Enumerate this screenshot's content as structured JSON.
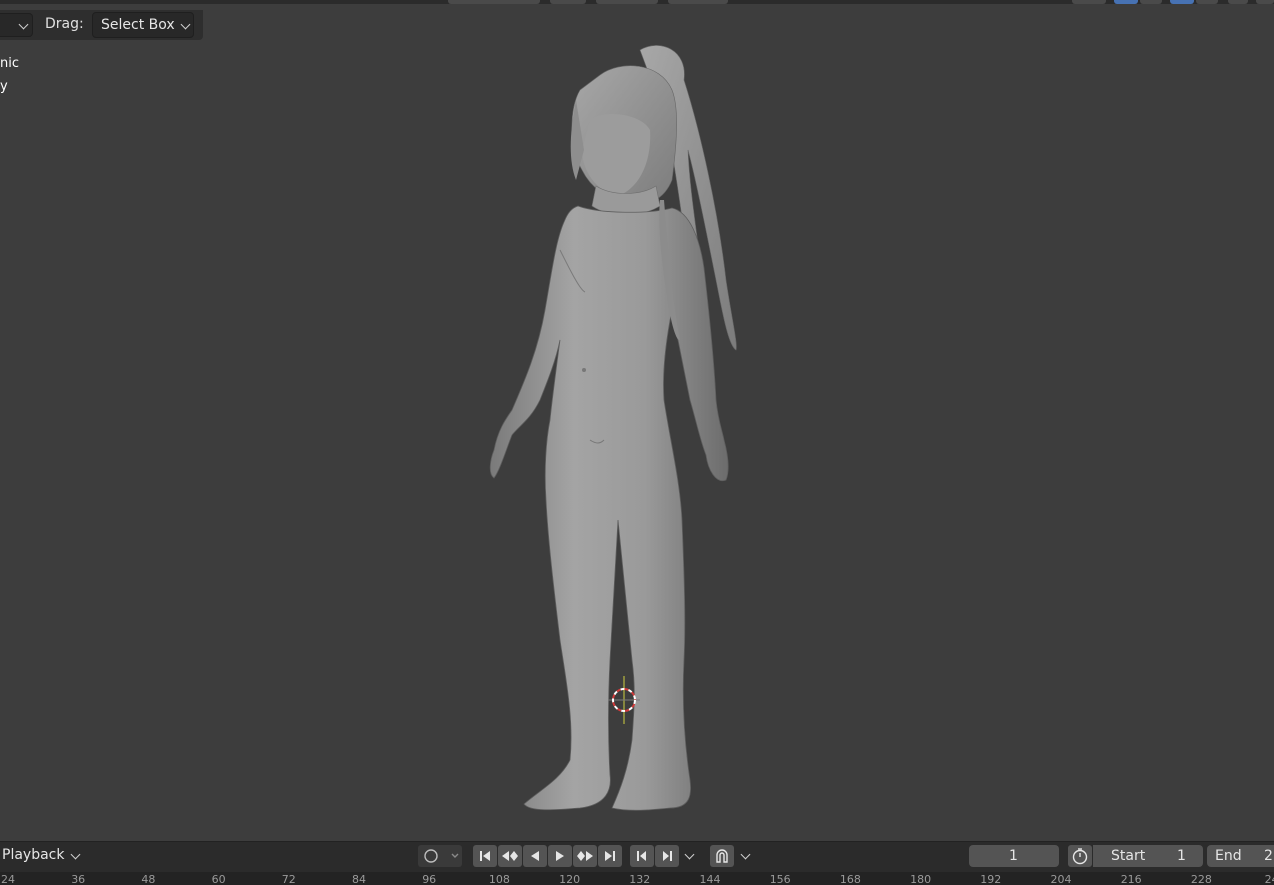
{
  "tool_settings": {
    "drag_label": "Drag:",
    "drag_value": "Select Box"
  },
  "overlay": {
    "line1": "nic",
    "line2": "y"
  },
  "timeline": {
    "playback_label": "Playback",
    "current_frame": "1",
    "start_label": "Start",
    "start_value": "1",
    "end_label": "End",
    "end_value": "2"
  },
  "ruler_ticks": [
    "24",
    "36",
    "48",
    "60",
    "72",
    "84",
    "96",
    "108",
    "120",
    "132",
    "144",
    "156",
    "168",
    "180",
    "192",
    "204",
    "216",
    "228",
    "24"
  ],
  "colors": {
    "viewport_bg": "#3d3d3d",
    "panel_bg": "#2b2b2b",
    "accent_blue": "#4772b3",
    "cursor_red": "#d23a3a"
  },
  "icons": {
    "keying": "circle-dot-icon",
    "jump_start": "jump-to-start-icon",
    "prev_keyframe": "prev-keyframe-icon",
    "play_reverse": "play-reverse-icon",
    "play": "play-icon",
    "next_keyframe": "next-keyframe-icon",
    "jump_end": "jump-to-end-icon",
    "prev_frame": "prev-frame-icon",
    "next_frame": "next-frame-icon",
    "snap": "magnet-icon",
    "clock": "stopwatch-icon"
  }
}
